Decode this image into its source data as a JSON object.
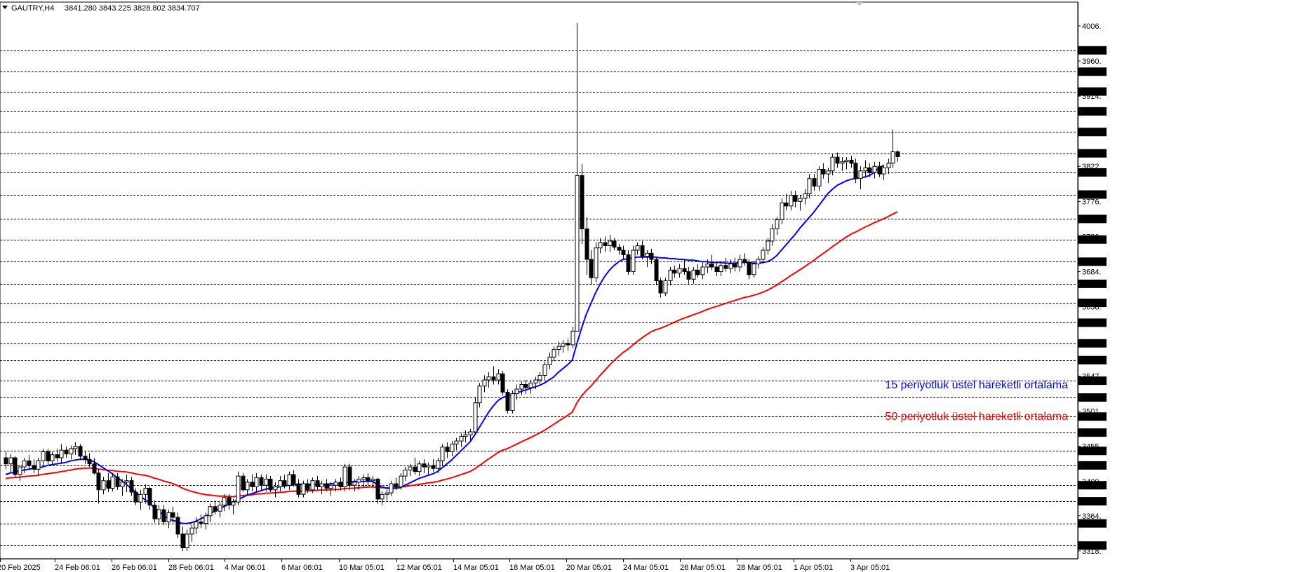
{
  "header": {
    "symbol_line": "GAUTRY,H4",
    "ohlc": "3841.280 3843.225 3828.802 3834.707"
  },
  "annotations": {
    "ema15": "15 periyotluk üstel hareketli ortalama",
    "ema50": "50 periyotluk üstel hareketli ortalama"
  },
  "colors": {
    "background": "#ffffff",
    "grid": "#000000",
    "candle": "#000000",
    "ema15": "#0000ff",
    "ema50": "#ff0000"
  },
  "chart_data": {
    "type": "candlestick",
    "timeframe": "H4",
    "ylim": [
      3305,
      4025
    ],
    "y_ticks": [
      4006,
      3960,
      3914,
      3868,
      3822,
      3776,
      3730,
      3684,
      3638,
      3592,
      3547,
      3501,
      3455,
      3409,
      3364,
      3318
    ],
    "y_tick_labels": [
      "4006.",
      "3960.",
      "3914.",
      "3868.",
      "3822.",
      "3776.",
      "3730.",
      "3684.",
      "3638.",
      "3592.",
      "3547.",
      "3501.",
      "3455.",
      "3409.",
      "3364.",
      "3318."
    ],
    "horizontal_levels": [
      3974,
      3946,
      3920,
      3894,
      3867,
      3839,
      3814,
      3785,
      3753,
      3726,
      3697,
      3668,
      3643,
      3617,
      3590,
      3568,
      3541,
      3519,
      3494,
      3473,
      3449,
      3430,
      3404,
      3383,
      3354,
      3325
    ],
    "horizontal_level_labels": [
      "3974.",
      "3946.",
      "3920.",
      "3894.",
      "3867.",
      "3839.",
      "3814.",
      "3785.",
      "3753.",
      "3726.",
      "3697.",
      "3668.",
      "3643.",
      "3617.",
      "3590.",
      "3568.",
      "3541.",
      "3519.",
      "3494.",
      "3473.",
      "3449.",
      "3430.",
      "3404.",
      "3383.",
      "3354.",
      "3325."
    ],
    "x_labels": [
      "20 Feb 2025",
      "24 Feb 06:01",
      "26 Feb 06:01",
      "28 Feb 06:01",
      "4 Mar 06:01",
      "6 Mar 06:01",
      "10 Mar 05:01",
      "12 Mar 05:01",
      "14 Mar 05:01",
      "18 Mar 05:01",
      "20 Mar 05:01",
      "24 Mar 05:01",
      "26 Mar 05:01",
      "28 Mar 05:01",
      "1 Apr 05:01",
      "3 Apr 05:01"
    ],
    "bars_per_label": 15,
    "candles": [
      [
        3440,
        3448,
        3425,
        3432
      ],
      [
        3432,
        3445,
        3420,
        3440
      ],
      [
        3440,
        3442,
        3415,
        3418
      ],
      [
        3418,
        3430,
        3410,
        3428
      ],
      [
        3428,
        3440,
        3420,
        3436
      ],
      [
        3436,
        3444,
        3425,
        3430
      ],
      [
        3430,
        3438,
        3420,
        3425
      ],
      [
        3425,
        3440,
        3418,
        3436
      ],
      [
        3436,
        3452,
        3430,
        3448
      ],
      [
        3448,
        3452,
        3432,
        3436
      ],
      [
        3436,
        3448,
        3430,
        3444
      ],
      [
        3444,
        3452,
        3435,
        3440
      ],
      [
        3440,
        3458,
        3432,
        3450
      ],
      [
        3450,
        3455,
        3440,
        3445
      ],
      [
        3445,
        3456,
        3438,
        3452
      ],
      [
        3452,
        3460,
        3444,
        3455
      ],
      [
        3455,
        3458,
        3438,
        3442
      ],
      [
        3442,
        3448,
        3432,
        3438
      ],
      [
        3438,
        3446,
        3428,
        3432
      ],
      [
        3432,
        3440,
        3418,
        3420
      ],
      [
        3420,
        3425,
        3380,
        3398
      ],
      [
        3398,
        3415,
        3392,
        3410
      ],
      [
        3410,
        3420,
        3395,
        3400
      ],
      [
        3400,
        3420,
        3396,
        3415
      ],
      [
        3415,
        3420,
        3398,
        3402
      ],
      [
        3402,
        3412,
        3390,
        3408
      ],
      [
        3408,
        3418,
        3395,
        3410
      ],
      [
        3410,
        3415,
        3390,
        3395
      ],
      [
        3395,
        3400,
        3378,
        3382
      ],
      [
        3382,
        3398,
        3372,
        3392
      ],
      [
        3392,
        3405,
        3380,
        3400
      ],
      [
        3400,
        3402,
        3372,
        3378
      ],
      [
        3378,
        3384,
        3355,
        3360
      ],
      [
        3360,
        3378,
        3352,
        3372
      ],
      [
        3372,
        3378,
        3352,
        3356
      ],
      [
        3356,
        3372,
        3348,
        3368
      ],
      [
        3368,
        3376,
        3355,
        3362
      ],
      [
        3362,
        3368,
        3335,
        3340
      ],
      [
        3340,
        3350,
        3318,
        3322
      ],
      [
        3322,
        3346,
        3318,
        3340
      ],
      [
        3340,
        3352,
        3330,
        3348
      ],
      [
        3348,
        3362,
        3340,
        3356
      ],
      [
        3356,
        3366,
        3348,
        3354
      ],
      [
        3354,
        3368,
        3346,
        3364
      ],
      [
        3364,
        3380,
        3356,
        3376
      ],
      [
        3376,
        3384,
        3366,
        3370
      ],
      [
        3370,
        3382,
        3362,
        3378
      ],
      [
        3378,
        3392,
        3370,
        3388
      ],
      [
        3388,
        3392,
        3372,
        3378
      ],
      [
        3378,
        3386,
        3366,
        3382
      ],
      [
        3382,
        3422,
        3378,
        3416
      ],
      [
        3416,
        3420,
        3395,
        3398
      ],
      [
        3398,
        3412,
        3390,
        3408
      ],
      [
        3408,
        3418,
        3396,
        3402
      ],
      [
        3402,
        3420,
        3396,
        3414
      ],
      [
        3414,
        3418,
        3398,
        3404
      ],
      [
        3404,
        3418,
        3396,
        3412
      ],
      [
        3412,
        3416,
        3395,
        3398
      ],
      [
        3398,
        3408,
        3388,
        3402
      ],
      [
        3402,
        3416,
        3396,
        3410
      ],
      [
        3410,
        3418,
        3400,
        3404
      ],
      [
        3404,
        3422,
        3398,
        3418
      ],
      [
        3418,
        3424,
        3402,
        3406
      ],
      [
        3406,
        3412,
        3388,
        3392
      ],
      [
        3392,
        3410,
        3388,
        3406
      ],
      [
        3406,
        3412,
        3394,
        3398
      ],
      [
        3398,
        3414,
        3394,
        3410
      ],
      [
        3410,
        3416,
        3398,
        3402
      ],
      [
        3402,
        3410,
        3392,
        3406
      ],
      [
        3406,
        3412,
        3396,
        3400
      ],
      [
        3400,
        3408,
        3390,
        3404
      ],
      [
        3404,
        3412,
        3396,
        3408
      ],
      [
        3408,
        3414,
        3398,
        3402
      ],
      [
        3402,
        3432,
        3396,
        3428
      ],
      [
        3428,
        3432,
        3398,
        3404
      ],
      [
        3404,
        3412,
        3396,
        3408
      ],
      [
        3408,
        3416,
        3398,
        3412
      ],
      [
        3412,
        3418,
        3402,
        3414
      ],
      [
        3414,
        3420,
        3404,
        3410
      ],
      [
        3410,
        3416,
        3400,
        3412
      ],
      [
        3412,
        3414,
        3380,
        3386
      ],
      [
        3386,
        3396,
        3378,
        3392
      ],
      [
        3392,
        3398,
        3384,
        3394
      ],
      [
        3394,
        3410,
        3390,
        3406
      ],
      [
        3406,
        3414,
        3398,
        3402
      ],
      [
        3402,
        3420,
        3398,
        3416
      ],
      [
        3416,
        3428,
        3410,
        3424
      ],
      [
        3424,
        3432,
        3416,
        3428
      ],
      [
        3428,
        3440,
        3418,
        3422
      ],
      [
        3422,
        3436,
        3416,
        3432
      ],
      [
        3432,
        3438,
        3420,
        3428
      ],
      [
        3428,
        3434,
        3418,
        3430
      ],
      [
        3430,
        3438,
        3422,
        3426
      ],
      [
        3426,
        3440,
        3420,
        3436
      ],
      [
        3436,
        3458,
        3430,
        3454
      ],
      [
        3454,
        3460,
        3440,
        3448
      ],
      [
        3448,
        3462,
        3442,
        3458
      ],
      [
        3458,
        3466,
        3450,
        3462
      ],
      [
        3462,
        3472,
        3454,
        3468
      ],
      [
        3468,
        3476,
        3460,
        3470
      ],
      [
        3470,
        3478,
        3462,
        3474
      ],
      [
        3474,
        3520,
        3470,
        3512
      ],
      [
        3512,
        3538,
        3506,
        3534
      ],
      [
        3534,
        3548,
        3526,
        3542
      ],
      [
        3542,
        3552,
        3532,
        3546
      ],
      [
        3546,
        3560,
        3536,
        3542
      ],
      [
        3542,
        3556,
        3536,
        3550
      ],
      [
        3550,
        3554,
        3522,
        3526
      ],
      [
        3526,
        3530,
        3498,
        3502
      ],
      [
        3502,
        3528,
        3498,
        3524
      ],
      [
        3524,
        3536,
        3516,
        3530
      ],
      [
        3530,
        3540,
        3522,
        3536
      ],
      [
        3536,
        3542,
        3524,
        3532
      ],
      [
        3532,
        3542,
        3524,
        3538
      ],
      [
        3538,
        3546,
        3530,
        3542
      ],
      [
        3542,
        3552,
        3536,
        3548
      ],
      [
        3548,
        3566,
        3542,
        3562
      ],
      [
        3562,
        3578,
        3556,
        3572
      ],
      [
        3572,
        3586,
        3566,
        3582
      ],
      [
        3582,
        3592,
        3574,
        3586
      ],
      [
        3586,
        3594,
        3578,
        3590
      ],
      [
        3590,
        3596,
        3580,
        3588
      ],
      [
        3588,
        3612,
        3584,
        3606
      ],
      [
        3606,
        4010,
        3620,
        3810
      ],
      [
        3810,
        3825,
        3720,
        3740
      ],
      [
        3740,
        3755,
        3680,
        3700
      ],
      [
        3700,
        3712,
        3666,
        3676
      ],
      [
        3676,
        3722,
        3670,
        3715
      ],
      [
        3715,
        3728,
        3708,
        3722
      ],
      [
        3722,
        3730,
        3710,
        3718
      ],
      [
        3718,
        3732,
        3710,
        3724
      ],
      [
        3724,
        3728,
        3712,
        3716
      ],
      [
        3716,
        3720,
        3706,
        3712
      ],
      [
        3712,
        3718,
        3700,
        3706
      ],
      [
        3706,
        3712,
        3680,
        3684
      ],
      [
        3684,
        3718,
        3680,
        3712
      ],
      [
        3712,
        3722,
        3706,
        3718
      ],
      [
        3718,
        3724,
        3700,
        3704
      ],
      [
        3704,
        3712,
        3690,
        3708
      ],
      [
        3708,
        3714,
        3694,
        3700
      ],
      [
        3700,
        3702,
        3666,
        3672
      ],
      [
        3672,
        3676,
        3650,
        3656
      ],
      [
        3656,
        3676,
        3652,
        3672
      ],
      [
        3672,
        3690,
        3666,
        3686
      ],
      [
        3686,
        3692,
        3676,
        3682
      ],
      [
        3682,
        3694,
        3676,
        3688
      ],
      [
        3688,
        3700,
        3680,
        3684
      ],
      [
        3684,
        3690,
        3668,
        3674
      ],
      [
        3674,
        3690,
        3668,
        3686
      ],
      [
        3686,
        3694,
        3676,
        3680
      ],
      [
        3680,
        3696,
        3674,
        3690
      ],
      [
        3690,
        3700,
        3682,
        3694
      ],
      [
        3694,
        3706,
        3686,
        3690
      ],
      [
        3690,
        3696,
        3678,
        3684
      ],
      [
        3684,
        3698,
        3678,
        3692
      ],
      [
        3692,
        3702,
        3684,
        3688
      ],
      [
        3688,
        3700,
        3682,
        3694
      ],
      [
        3694,
        3702,
        3684,
        3690
      ],
      [
        3690,
        3706,
        3684,
        3700
      ],
      [
        3700,
        3708,
        3692,
        3696
      ],
      [
        3696,
        3700,
        3674,
        3680
      ],
      [
        3680,
        3698,
        3676,
        3694
      ],
      [
        3694,
        3704,
        3688,
        3700
      ],
      [
        3700,
        3716,
        3694,
        3712
      ],
      [
        3712,
        3728,
        3706,
        3724
      ],
      [
        3724,
        3746,
        3718,
        3740
      ],
      [
        3740,
        3756,
        3732,
        3752
      ],
      [
        3752,
        3780,
        3746,
        3774
      ],
      [
        3774,
        3786,
        3764,
        3770
      ],
      [
        3770,
        3790,
        3764,
        3784
      ],
      [
        3784,
        3790,
        3768,
        3776
      ],
      [
        3776,
        3784,
        3764,
        3780
      ],
      [
        3780,
        3792,
        3772,
        3786
      ],
      [
        3786,
        3812,
        3780,
        3806
      ],
      [
        3806,
        3812,
        3790,
        3796
      ],
      [
        3796,
        3822,
        3790,
        3818
      ],
      [
        3818,
        3826,
        3806,
        3812
      ],
      [
        3812,
        3820,
        3800,
        3816
      ],
      [
        3816,
        3838,
        3810,
        3834
      ],
      [
        3834,
        3840,
        3820,
        3826
      ],
      [
        3826,
        3834,
        3816,
        3828
      ],
      [
        3828,
        3834,
        3818,
        3830
      ],
      [
        3830,
        3836,
        3820,
        3826
      ],
      [
        3826,
        3832,
        3800,
        3806
      ],
      [
        3806,
        3822,
        3792,
        3816
      ],
      [
        3816,
        3830,
        3808,
        3820
      ],
      [
        3820,
        3826,
        3808,
        3814
      ],
      [
        3814,
        3828,
        3806,
        3822
      ],
      [
        3822,
        3828,
        3808,
        3812
      ],
      [
        3812,
        3824,
        3804,
        3820
      ],
      [
        3820,
        3832,
        3812,
        3826
      ],
      [
        3826,
        3870,
        3820,
        3841
      ],
      [
        3841,
        3843,
        3828,
        3834.707
      ]
    ],
    "ema15": [
      3418,
      3420,
      3421,
      3423,
      3424,
      3425,
      3426,
      3427,
      3428,
      3430,
      3431,
      3432,
      3433,
      3434,
      3436,
      3437,
      3438,
      3438,
      3437,
      3435,
      3431,
      3427,
      3423,
      3419,
      3414,
      3410,
      3405,
      3400,
      3395,
      3390,
      3385,
      3380,
      3375,
      3370,
      3365,
      3360,
      3358,
      3356,
      3354,
      3354,
      3355,
      3357,
      3360,
      3363,
      3367,
      3370,
      3373,
      3376,
      3379,
      3382,
      3385,
      3388,
      3391,
      3393,
      3395,
      3397,
      3399,
      3400,
      3401,
      3402,
      3403,
      3404,
      3405,
      3405,
      3405,
      3405,
      3405,
      3405,
      3405,
      3405,
      3406,
      3406,
      3406,
      3407,
      3408,
      3409,
      3409,
      3409,
      3409,
      3409,
      3405,
      3402,
      3400,
      3400,
      3400,
      3401,
      3404,
      3407,
      3410,
      3413,
      3415,
      3417,
      3419,
      3422,
      3427,
      3432,
      3437,
      3443,
      3449,
      3455,
      3461,
      3470,
      3480,
      3490,
      3500,
      3508,
      3515,
      3519,
      3521,
      3523,
      3525,
      3527,
      3529,
      3531,
      3533,
      3535,
      3538,
      3542,
      3546,
      3552,
      3557,
      3562,
      3568,
      3590,
      3610,
      3628,
      3642,
      3656,
      3668,
      3678,
      3686,
      3692,
      3697,
      3700,
      3701,
      3702,
      3703,
      3703,
      3703,
      3703,
      3703,
      3702,
      3702,
      3701,
      3701,
      3700,
      3700,
      3699,
      3699,
      3698,
      3697,
      3697,
      3696,
      3696,
      3696,
      3695,
      3695,
      3695,
      3696,
      3696,
      3696,
      3695,
      3695,
      3696,
      3697,
      3700,
      3705,
      3712,
      3719,
      3726,
      3733,
      3741,
      3748,
      3755,
      3762,
      3770,
      3778,
      3786,
      3792,
      3797,
      3800,
      3803,
      3805,
      3806,
      3807,
      3808,
      3810,
      3814,
      3820,
      3823
    ]
  }
}
